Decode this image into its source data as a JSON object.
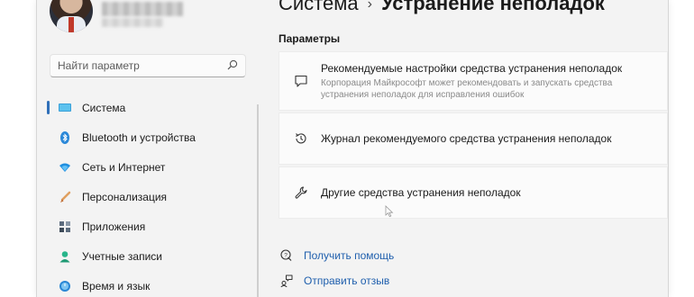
{
  "sidebar": {
    "search_placeholder": "Найти параметр",
    "items": [
      {
        "label": "Система",
        "icon": "display-icon"
      },
      {
        "label": "Bluetooth и устройства",
        "icon": "bluetooth-icon"
      },
      {
        "label": "Сеть и Интернет",
        "icon": "wifi-icon"
      },
      {
        "label": "Персонализация",
        "icon": "brush-icon"
      },
      {
        "label": "Приложения",
        "icon": "apps-icon"
      },
      {
        "label": "Учетные записи",
        "icon": "account-icon"
      },
      {
        "label": "Время и язык",
        "icon": "globe-clock-icon"
      }
    ],
    "active_index": 0
  },
  "header": {
    "crumb_parent": "Система",
    "separator": "›",
    "crumb_current": "Устранение неполадок"
  },
  "main": {
    "section_title": "Параметры",
    "cards": [
      {
        "title": "Рекомендуемые настройки средства устранения неполадок",
        "description": "Корпорация Майкрософт может рекомендовать и запускать средства устранения неполадок для исправления ошибок",
        "icon": "chat-bubble-icon"
      },
      {
        "title": "Журнал рекомендуемого средства устранения неполадок",
        "icon": "history-icon"
      },
      {
        "title": "Другие средства устранения неполадок",
        "icon": "wrench-icon"
      }
    ],
    "links": [
      {
        "label": "Получить помощь",
        "icon": "help-icon"
      },
      {
        "label": "Отправить отзыв",
        "icon": "feedback-icon"
      }
    ]
  },
  "colors": {
    "accent": "#2f6fb8",
    "link": "#1f5fad",
    "window_bg": "#f3f3f3",
    "card_bg": "#fbfbfb"
  }
}
